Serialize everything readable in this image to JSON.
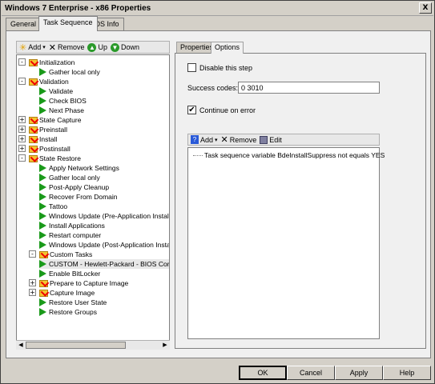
{
  "window": {
    "title": "Windows 7 Enterprise - x86 Properties",
    "close_label": "X"
  },
  "tabs": [
    {
      "label": "General"
    },
    {
      "label": "Task Sequence"
    },
    {
      "label": "OS Info"
    }
  ],
  "toolbar": {
    "add_label": "Add",
    "remove_label": "Remove",
    "up_label": "Up",
    "down_label": "Down"
  },
  "tree": [
    {
      "label": "Initialization",
      "type": "folder",
      "level": 0,
      "expander": "-"
    },
    {
      "label": "Gather local only",
      "type": "step",
      "level": 1
    },
    {
      "label": "Validation",
      "type": "folder",
      "level": 0,
      "expander": "-"
    },
    {
      "label": "Validate",
      "type": "step",
      "level": 1
    },
    {
      "label": "Check BIOS",
      "type": "step",
      "level": 1
    },
    {
      "label": "Next Phase",
      "type": "step",
      "level": 1
    },
    {
      "label": "State Capture",
      "type": "folder",
      "level": 0,
      "expander": "+"
    },
    {
      "label": "Preinstall",
      "type": "folder",
      "level": 0,
      "expander": "+"
    },
    {
      "label": "Install",
      "type": "folder",
      "level": 0,
      "expander": "+"
    },
    {
      "label": "Postinstall",
      "type": "folder",
      "level": 0,
      "expander": "+"
    },
    {
      "label": "State Restore",
      "type": "folder",
      "level": 0,
      "expander": "-"
    },
    {
      "label": "Apply Network Settings",
      "type": "step",
      "level": 1
    },
    {
      "label": "Gather local only",
      "type": "step",
      "level": 1
    },
    {
      "label": "Post-Apply Cleanup",
      "type": "step",
      "level": 1
    },
    {
      "label": "Recover From Domain",
      "type": "step",
      "level": 1
    },
    {
      "label": "Tattoo",
      "type": "step",
      "level": 1
    },
    {
      "label": "Windows Update (Pre-Application Installa",
      "type": "step",
      "level": 1
    },
    {
      "label": "Install Applications",
      "type": "step",
      "level": 1
    },
    {
      "label": "Restart computer",
      "type": "step",
      "level": 1
    },
    {
      "label": "Windows Update (Post-Application Install",
      "type": "step",
      "level": 1
    },
    {
      "label": "Custom Tasks",
      "type": "folder",
      "level": 1,
      "expander": "-"
    },
    {
      "label": "CUSTOM - Hewlett-Packard - BIOS Confi",
      "type": "step",
      "level": 1,
      "selected": true
    },
    {
      "label": "Enable BitLocker",
      "type": "step",
      "level": 1
    },
    {
      "label": "Prepare to Capture Image",
      "type": "folder",
      "level": 1,
      "expander": "+"
    },
    {
      "label": "Capture Image",
      "type": "folder",
      "level": 1,
      "expander": "+"
    },
    {
      "label": "Restore User State",
      "type": "step",
      "level": 1
    },
    {
      "label": "Restore Groups",
      "type": "step",
      "level": 1
    }
  ],
  "right_tabs": [
    {
      "label": "Properties"
    },
    {
      "label": "Options"
    }
  ],
  "options": {
    "disable_label": "Disable this step",
    "success_label": "Success codes:",
    "success_value": "0 3010",
    "continue_label": "Continue on error",
    "continue_checked": true
  },
  "conditions_toolbar": {
    "add_label": "Add",
    "remove_label": "Remove",
    "edit_label": "Edit"
  },
  "conditions": [
    "Task sequence variable BdeInstallSuppress not equals YES"
  ],
  "buttons": {
    "ok": "OK",
    "cancel": "Cancel",
    "apply": "Apply",
    "help": "Help"
  }
}
